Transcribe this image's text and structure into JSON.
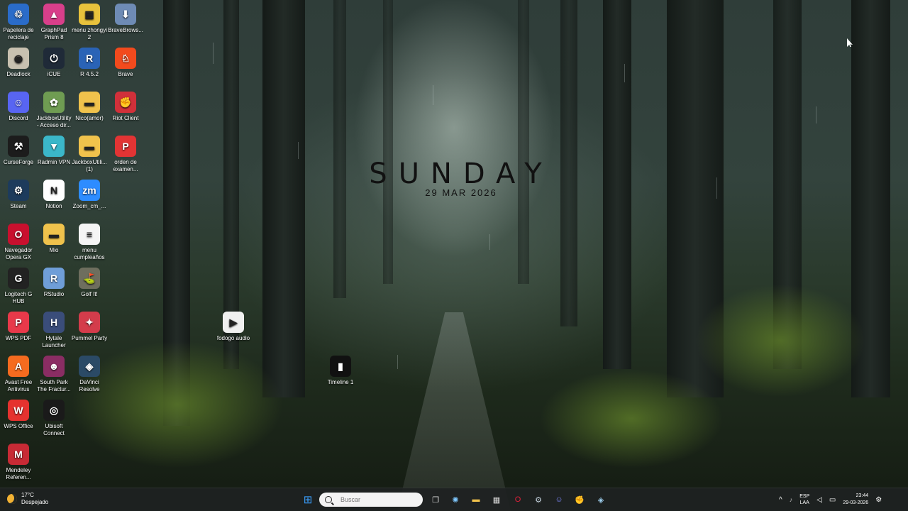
{
  "wallpaper": {
    "widget": {
      "day": "SUNDAY",
      "date": "29 MAR 2026"
    }
  },
  "desktop_icons": [
    {
      "label": "Papelera de reciclaje",
      "icon": "recycle-bin-icon",
      "glyph": "♲",
      "color": "#2a6cc9"
    },
    {
      "label": "GraphPad Prism 8",
      "icon": "graphpad-icon",
      "glyph": "▲",
      "color": "#d83f8a"
    },
    {
      "label": "menu zhongyi 2",
      "icon": "spreadsheet-icon",
      "glyph": "▦",
      "color": "#e8c23c"
    },
    {
      "label": "BraveBrows...",
      "icon": "brave-installer-icon",
      "glyph": "⬇",
      "color": "#6e8bb5"
    },
    {
      "label": "Deadlock",
      "icon": "deadlock-icon",
      "glyph": "◉",
      "color": "#c8c1b0"
    },
    {
      "label": "iCUE",
      "icon": "icue-icon",
      "glyph": "⏻",
      "color": "#1f2a38"
    },
    {
      "label": "R 4.5.2",
      "icon": "r-icon",
      "glyph": "R",
      "color": "#2a63b6"
    },
    {
      "label": "Brave",
      "icon": "brave-icon",
      "glyph": "♘",
      "color": "#f24a1d"
    },
    {
      "label": "Discord",
      "icon": "discord-icon",
      "glyph": "☺",
      "color": "#5865f2"
    },
    {
      "label": "JackboxUtility - Acceso dir...",
      "icon": "jackbox-utility-icon",
      "glyph": "✿",
      "color": "#6f9c52"
    },
    {
      "label": "Nico(amor)",
      "icon": "folder-icon",
      "glyph": "▬",
      "color": "#f0c24c"
    },
    {
      "label": "Riot Client",
      "icon": "riot-client-icon",
      "glyph": "✊",
      "color": "#d1303a"
    },
    {
      "label": "CurseForge",
      "icon": "curseforge-icon",
      "glyph": "⚒",
      "color": "#1c1c1c"
    },
    {
      "label": "Radmin VPN",
      "icon": "radmin-vpn-icon",
      "glyph": "▼",
      "color": "#3bb7c9"
    },
    {
      "label": "JackboxUtili... (1)",
      "icon": "folder-icon",
      "glyph": "▬",
      "color": "#f0c24c"
    },
    {
      "label": "orden de examen...",
      "icon": "pdf-icon",
      "glyph": "P",
      "color": "#e23434"
    },
    {
      "label": "Steam",
      "icon": "steam-icon",
      "glyph": "⚙",
      "color": "#1d3b5c"
    },
    {
      "label": "Notion",
      "icon": "notion-icon",
      "glyph": "N",
      "color": "#ffffff"
    },
    {
      "label": "Zoom_cm_...",
      "icon": "zoom-icon",
      "glyph": "zm",
      "color": "#2d8cff"
    },
    {
      "label": "Navegador Opera GX",
      "icon": "opera-gx-icon",
      "glyph": "O",
      "color": "#c8102e"
    },
    {
      "label": "Mio",
      "icon": "folder-icon",
      "glyph": "▬",
      "color": "#f0c24c"
    },
    {
      "label": "menu cumpleaños",
      "icon": "document-icon",
      "glyph": "≡",
      "color": "#f5f5f5"
    },
    {
      "label": "Logitech G HUB",
      "icon": "logitech-ghub-icon",
      "glyph": "G",
      "color": "#222222"
    },
    {
      "label": "RStudio",
      "icon": "rstudio-icon",
      "glyph": "R",
      "color": "#6f9ed8"
    },
    {
      "label": "Golf It!",
      "icon": "golf-it-icon",
      "glyph": "⛳",
      "color": "#6e6e5e"
    },
    {
      "label": "WPS PDF",
      "icon": "wps-pdf-icon",
      "glyph": "P",
      "color": "#e8394a"
    },
    {
      "label": "Hytale Launcher",
      "icon": "hytale-icon",
      "glyph": "H",
      "color": "#3a4d7a"
    },
    {
      "label": "Pummel Party",
      "icon": "pummel-party-icon",
      "glyph": "✦",
      "color": "#d43c4b"
    },
    {
      "label": "Avast Free Antivirus",
      "icon": "avast-icon",
      "glyph": "A",
      "color": "#f56b1f"
    },
    {
      "label": "South Park The Fractur...",
      "icon": "south-park-icon",
      "glyph": "☻",
      "color": "#8a2d63"
    },
    {
      "label": "DaVinci Resolve",
      "icon": "davinci-resolve-icon",
      "glyph": "◈",
      "color": "#2b4a66"
    },
    {
      "label": "WPS Office",
      "icon": "wps-office-icon",
      "glyph": "W",
      "color": "#e5322f"
    },
    {
      "label": "Ubisoft Connect",
      "icon": "ubisoft-icon",
      "glyph": "◎",
      "color": "#1a1a1a"
    },
    {
      "label": "Mendeley Referen...",
      "icon": "mendeley-icon",
      "glyph": "M",
      "color": "#c72a35"
    },
    {
      "label": "fodogo audio",
      "icon": "audio-file-icon",
      "glyph": "▶",
      "color": "#f0f0f0"
    },
    {
      "label": "Timeline 1",
      "icon": "video-file-icon",
      "glyph": "▮",
      "color": "#111111"
    }
  ],
  "taskbar": {
    "weather": {
      "temp": "17°C",
      "condition": "Despejado"
    },
    "search_placeholder": "Buscar",
    "pinned": [
      {
        "icon": "windows-start-icon",
        "glyph": "⊞",
        "color": "#3aa0ff"
      },
      {
        "icon": "task-view-icon",
        "glyph": "❐",
        "color": "#dddddd"
      },
      {
        "icon": "copilot-icon",
        "glyph": "✺",
        "color": "#7fc8ff"
      },
      {
        "icon": "file-explorer-icon",
        "glyph": "▬",
        "color": "#f0c24c"
      },
      {
        "icon": "microsoft-store-icon",
        "glyph": "▦",
        "color": "#dddddd"
      },
      {
        "icon": "opera-gx-icon",
        "glyph": "O",
        "color": "#e0203a"
      },
      {
        "icon": "steam-icon",
        "glyph": "⚙",
        "color": "#c7d5e0"
      },
      {
        "icon": "discord-icon",
        "glyph": "☺",
        "color": "#7b86f7"
      },
      {
        "icon": "riot-client-icon",
        "glyph": "✊",
        "color": "#e04a52"
      },
      {
        "icon": "davinci-resolve-icon",
        "glyph": "◈",
        "color": "#9fd0ef"
      }
    ],
    "tray": {
      "language_top": "ESP",
      "language_bottom": "LAA",
      "time": "23:44",
      "date": "29-03-2026"
    }
  }
}
